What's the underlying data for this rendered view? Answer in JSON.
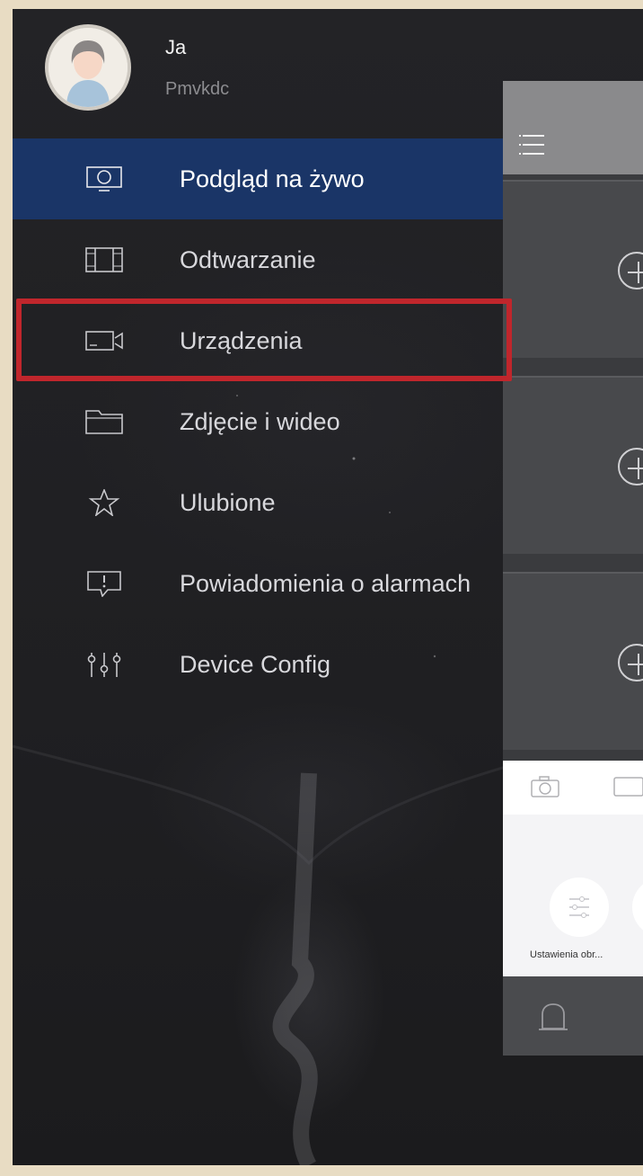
{
  "profile": {
    "name": "Ja",
    "user_id": "Pmvkdc",
    "avatar_icon": "user-avatar-icon"
  },
  "menu": {
    "items": [
      {
        "label": "Podgląd na żywo",
        "icon": "live-monitor-icon",
        "active": true
      },
      {
        "label": "Odtwarzanie",
        "icon": "film-strip-icon",
        "active": false
      },
      {
        "label": "Urządzenia",
        "icon": "video-camera-icon",
        "active": false,
        "highlighted": true
      },
      {
        "label": "Zdjęcie i wideo",
        "icon": "folder-icon",
        "active": false
      },
      {
        "label": "Ulubione",
        "icon": "star-icon",
        "active": false
      },
      {
        "label": "Powiadomienia o alarmach",
        "icon": "alarm-message-icon",
        "active": false
      },
      {
        "label": "Device Config",
        "icon": "sliders-icon",
        "active": false
      }
    ]
  },
  "peek": {
    "menu_icon": "hamburger-icon",
    "add_icon": "plus-circle-icon",
    "toolbar_icons": [
      "camera-icon",
      "screen-icon"
    ],
    "panel_caption": "Ustawienia obr...",
    "bottom_icon": "alarm-bell-icon"
  },
  "colors": {
    "active_row": "#1a3567",
    "highlight_border": "#c0262c",
    "drawer_bg": "#1e1e20"
  }
}
